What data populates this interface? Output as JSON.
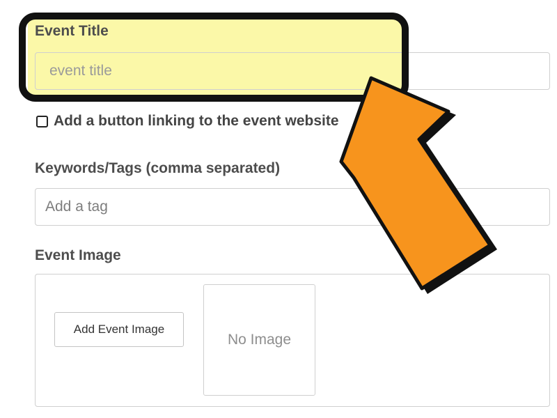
{
  "event_title": {
    "label": "Event Title",
    "placeholder": "event title"
  },
  "website_button": {
    "label": "Add a button linking to the event website",
    "checked": false
  },
  "tags": {
    "label": "Keywords/Tags (comma separated)",
    "placeholder": "Add a tag"
  },
  "event_image": {
    "label": "Event Image",
    "add_button_label": "Add Event Image",
    "preview_text": "No Image"
  },
  "annotation": {
    "arrow_icon": "pointing-arrow-icon",
    "callout_color": "#111111",
    "arrow_color": "#f7941d",
    "highlight_color": "#fbf8a8"
  }
}
